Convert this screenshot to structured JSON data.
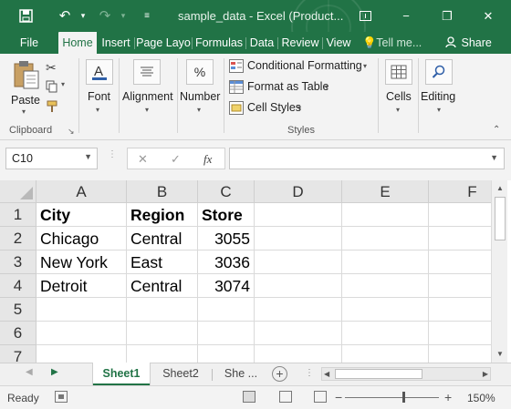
{
  "window": {
    "title": "sample_data - Excel (Product...",
    "accent_color": "#217346",
    "icons": [
      "save-icon",
      "undo-icon",
      "redo-icon",
      "customize-qat-icon",
      "ribbon-display-icon",
      "minimize-icon",
      "restore-icon",
      "close-icon"
    ],
    "window_buttons": [
      "−",
      "❐",
      "✕"
    ]
  },
  "tabs": {
    "file": "File",
    "items": [
      "Home",
      "Insert",
      "Page Layo",
      "Formulas",
      "Data",
      "Review",
      "View"
    ],
    "active": "Home",
    "tell_me": "Tell me...",
    "share": "Share"
  },
  "ribbon": {
    "clipboard": {
      "paste": "Paste",
      "group_label": "Clipboard"
    },
    "font": {
      "label": "Font"
    },
    "alignment": {
      "label": "Alignment"
    },
    "number": {
      "label": "Number",
      "icon_text": "%"
    },
    "styles": {
      "conditional_formatting": "Conditional Formatting",
      "format_as_table": "Format as Table",
      "cell_styles": "Cell Styles",
      "group_label": "Styles"
    },
    "cells": {
      "label": "Cells"
    },
    "editing": {
      "label": "Editing"
    }
  },
  "formula_bar": {
    "name_box": "C10",
    "cancel_glyph": "✕",
    "enter_glyph": "✓",
    "fx_label": "fx",
    "value": ""
  },
  "grid": {
    "columns": [
      "A",
      "B",
      "C",
      "D",
      "E",
      "F"
    ],
    "rows": [
      "1",
      "2",
      "3",
      "4",
      "5",
      "6",
      "7"
    ],
    "cells": {
      "A1": "City",
      "B1": "Region",
      "C1": "Store",
      "A2": "Chicago",
      "B2": "Central",
      "C2": "3055",
      "A3": "New York",
      "B3": "East",
      "C3": "3036",
      "A4": "Detroit",
      "B4": "Central",
      "C4": "3074"
    }
  },
  "sheets": {
    "tabs": [
      "Sheet1",
      "Sheet2",
      "She ..."
    ],
    "active": "Sheet1"
  },
  "status": {
    "ready": "Ready",
    "zoom": "150%",
    "zoom_level_fraction": 0.62
  }
}
